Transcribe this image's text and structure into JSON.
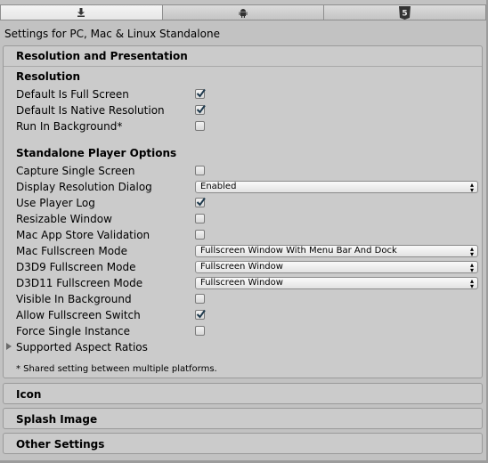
{
  "tabs": [
    {
      "icon": "download-icon",
      "active": true
    },
    {
      "icon": "android-icon",
      "active": false
    },
    {
      "icon": "html5-icon",
      "active": false
    }
  ],
  "header": {
    "title": "Settings for PC, Mac & Linux Standalone"
  },
  "panel": {
    "title": "Resolution and Presentation",
    "resolution": {
      "heading": "Resolution",
      "default_full_screen": {
        "label": "Default Is Full Screen",
        "checked": true
      },
      "default_native_resolution": {
        "label": "Default Is Native Resolution",
        "checked": true
      },
      "run_in_background": {
        "label": "Run In Background*",
        "checked": false
      }
    },
    "standalone": {
      "heading": "Standalone Player Options",
      "capture_single_screen": {
        "label": "Capture Single Screen",
        "checked": false
      },
      "display_resolution_dialog": {
        "label": "Display Resolution Dialog",
        "value": "Enabled"
      },
      "use_player_log": {
        "label": "Use Player Log",
        "checked": true
      },
      "resizable_window": {
        "label": "Resizable Window",
        "checked": false
      },
      "mac_app_store_validation": {
        "label": "Mac App Store Validation",
        "checked": false
      },
      "mac_fullscreen_mode": {
        "label": "Mac Fullscreen Mode",
        "value": "Fullscreen Window With Menu Bar And Dock"
      },
      "d3d9_fullscreen_mode": {
        "label": "D3D9 Fullscreen Mode",
        "value": "Fullscreen Window"
      },
      "d3d11_fullscreen_mode": {
        "label": "D3D11 Fullscreen Mode",
        "value": "Fullscreen Window"
      },
      "visible_in_background": {
        "label": "Visible In Background",
        "checked": false
      },
      "allow_fullscreen_switch": {
        "label": "Allow Fullscreen Switch",
        "checked": true
      },
      "force_single_instance": {
        "label": "Force Single Instance",
        "checked": false
      },
      "supported_aspect_ratios": {
        "label": "Supported Aspect Ratios"
      }
    },
    "note": "* Shared setting between multiple platforms."
  },
  "sections": {
    "icon": "Icon",
    "splash_image": "Splash Image",
    "other_settings": "Other Settings"
  }
}
